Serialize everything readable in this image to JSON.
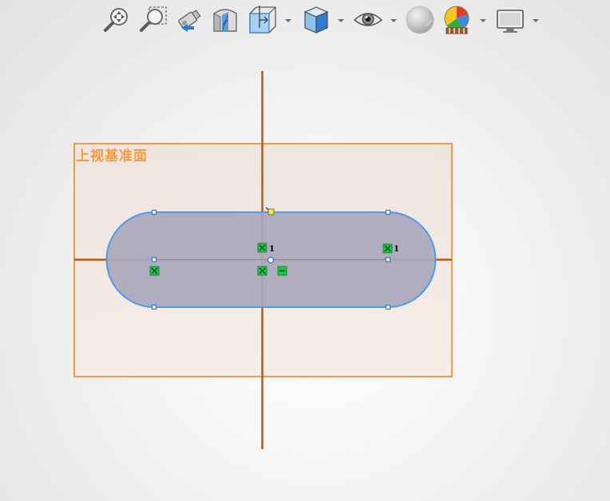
{
  "toolbar": {
    "items": [
      {
        "name": "zoom-to-fit",
        "icon": "zoom-to-fit-icon"
      },
      {
        "name": "zoom-to-area",
        "icon": "zoom-to-area-icon"
      },
      {
        "name": "previous-view",
        "icon": "previous-view-icon"
      },
      {
        "name": "section-view",
        "icon": "section-view-icon"
      },
      {
        "name": "view-orientation",
        "icon": "view-orientation-icon",
        "dropdown": true
      },
      {
        "name": "display-style",
        "icon": "display-style-icon",
        "dropdown": true
      },
      {
        "name": "hide-show-items",
        "icon": "eye-icon",
        "dropdown": true
      },
      {
        "name": "edit-appearance",
        "icon": "appearance-sphere-icon",
        "state": "disabled"
      },
      {
        "name": "apply-scene",
        "icon": "scene-icon",
        "dropdown": true
      },
      {
        "name": "view-settings",
        "icon": "monitor-icon",
        "dropdown": true
      }
    ]
  },
  "sketch": {
    "plane_label": "上视基准面",
    "relation_labels": [
      "1",
      "1"
    ],
    "colors": {
      "plane_border": "#e88a1f",
      "plane_label": "#f29b3c",
      "axis": "#c0560f",
      "slot_fill": "#aaa7bd",
      "slot_stroke": "#4e9be8",
      "relation_icon": "#1fc24a",
      "endpoint": "#2f78c8"
    }
  }
}
